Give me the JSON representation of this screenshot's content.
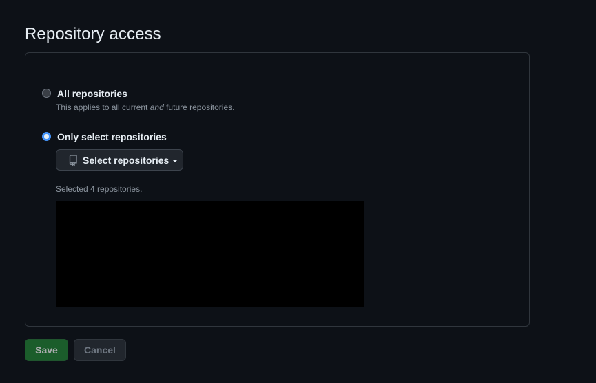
{
  "page_title": "Repository access",
  "options": {
    "all": {
      "label": "All repositories",
      "note_before": "This applies to all current ",
      "note_em": "and",
      "note_after": " future repositories.",
      "checked": false
    },
    "select": {
      "label": "Only select repositories",
      "checked": true
    }
  },
  "select_button": {
    "label": "Select repositories",
    "icon": "repo-icon"
  },
  "selected_count_text": "Selected 4 repositories.",
  "actions": {
    "save_label": "Save",
    "cancel_label": "Cancel"
  },
  "colors": {
    "background": "#0d1117",
    "border": "#30363d",
    "accent": "#4493f8",
    "save": "#238636"
  }
}
